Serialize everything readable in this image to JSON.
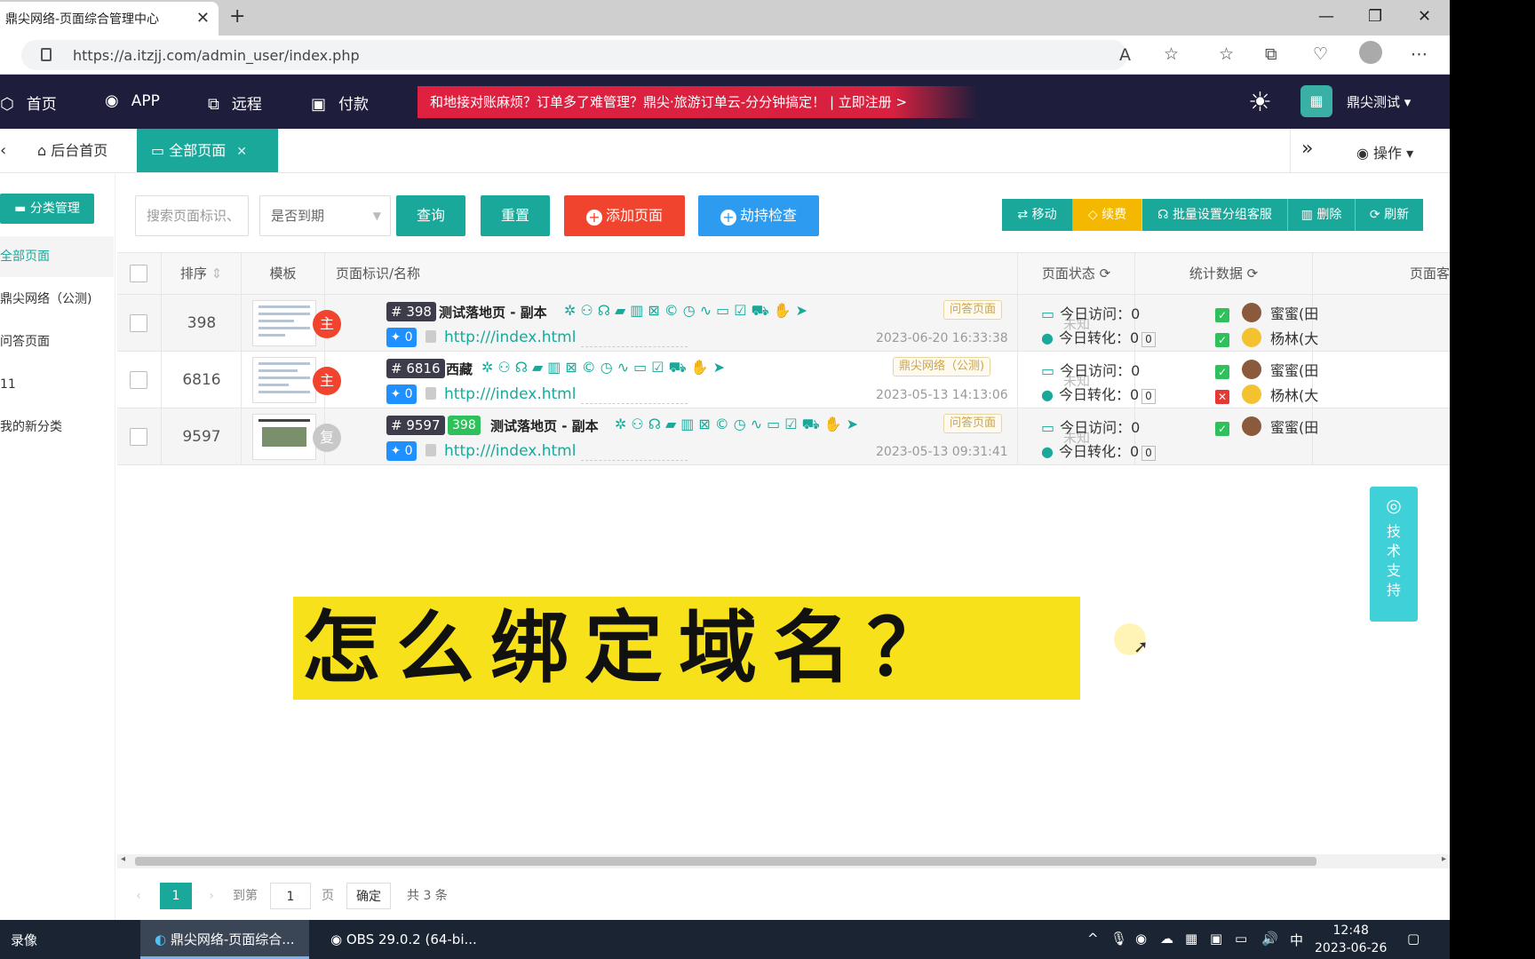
{
  "browser": {
    "tab_title": "鼎尖网络-页面综合管理中心",
    "url": "https://a.itzjj.com/admin_user/index.php"
  },
  "nav": {
    "items": [
      "首页",
      "APP",
      "远程",
      "付款"
    ],
    "ad_text": "和地接对账麻烦？订单多了难管理？鼎尖·旅游订单云-分分钟搞定！ | 立即注册 >",
    "user": "鼎尖测试"
  },
  "tabs": {
    "home": "后台首页",
    "active": "全部页面",
    "op": "操作"
  },
  "sidebar": {
    "button": "分类管理",
    "items": [
      "全部页面",
      "鼎尖网络（公测)",
      "问答页面",
      "11",
      "我的新分类"
    ]
  },
  "toolbar": {
    "search_placeholder": "搜索页面标识、",
    "select": "是否到期",
    "query": "查询",
    "reset": "重置",
    "add": "添加页面",
    "hijack": "劫持检查",
    "move": "移动",
    "renew": "续费",
    "batch": "批量设置分组客服",
    "delete": "删除",
    "refresh": "刷新"
  },
  "table": {
    "headers": [
      "排序",
      "模板",
      "页面标识/名称",
      "页面状态",
      "统计数据",
      "页面客"
    ],
    "rows": [
      {
        "sort": "398",
        "avatar": "主",
        "id": "# 398",
        "group_id": "",
        "name": "测试落地页 - 副本",
        "tag": "问答页面",
        "walk": "0",
        "link": "http:///index.html",
        "date": "2023-06-20 16:33:38",
        "status": "未知",
        "visit": "今日访问：0",
        "convert": "今日转化：0",
        "conv_box": "0",
        "svc1": "蜜蜜(田",
        "svc2": "杨林(大"
      },
      {
        "sort": "6816",
        "avatar": "主",
        "id": "# 6816",
        "group_id": "",
        "name": "西藏",
        "tag": "鼎尖网络（公测)",
        "walk": "0",
        "link": "http:///index.html",
        "date": "2023-05-13 14:13:06",
        "status": "未知",
        "visit": "今日访问：0",
        "convert": "今日转化：0",
        "conv_box": "0",
        "svc1": "蜜蜜(田",
        "svc2": "杨林(大"
      },
      {
        "sort": "9597",
        "avatar": "复",
        "id": "# 9597",
        "group_id": "398",
        "name": "测试落地页 - 副本",
        "tag": "问答页面",
        "walk": "0",
        "link": "http:///index.html",
        "date": "2023-05-13 09:31:41",
        "status": "未知",
        "visit": "今日访问：0",
        "convert": "今日转化：0",
        "conv_box": "0",
        "svc1": "蜜蜜(田",
        "svc2": ""
      }
    ]
  },
  "pager": {
    "current": "1",
    "goto": "到第",
    "page_input": "1",
    "page_unit": "页",
    "confirm": "确定",
    "total": "共 3 条"
  },
  "overlay": {
    "title": "怎么绑定域名？",
    "support": "技术支持"
  },
  "taskbar": {
    "left": "录像",
    "edge_app": "鼎尖网络-页面综合...",
    "obs_app": "OBS 29.0.2 (64-bi...",
    "ime": "中",
    "time": "12:48",
    "date": "2023-06-26"
  }
}
